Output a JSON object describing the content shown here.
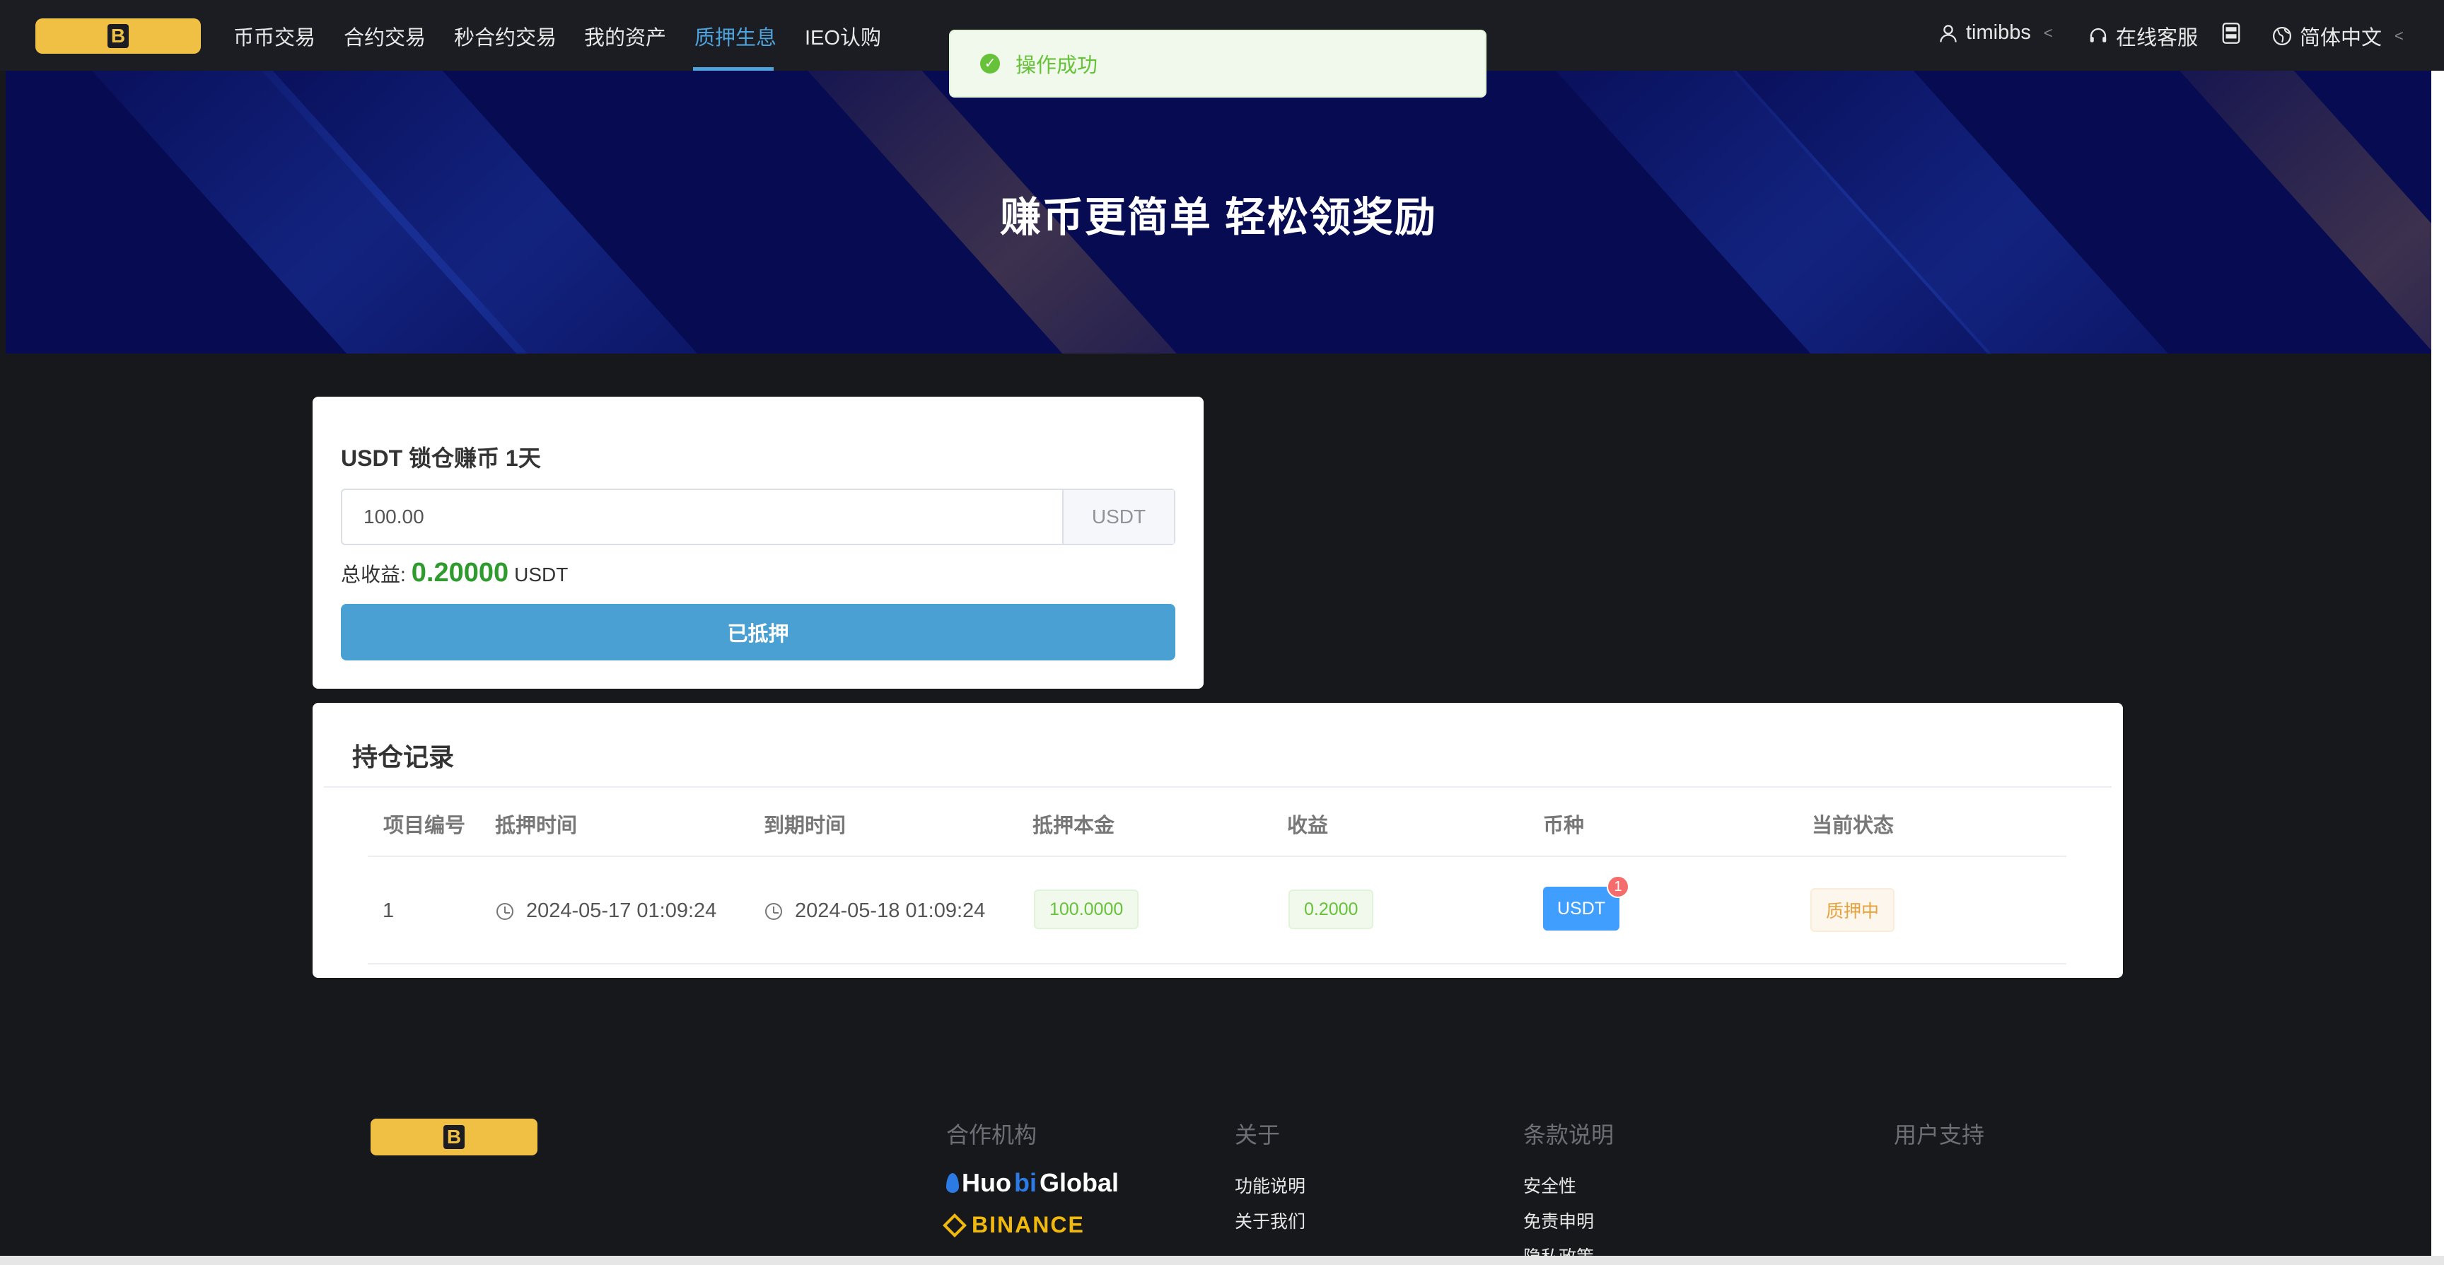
{
  "nav": {
    "items": [
      {
        "label": "币币交易"
      },
      {
        "label": "合约交易"
      },
      {
        "label": "秒合约交易"
      },
      {
        "label": "我的资产"
      },
      {
        "label": "质押生息",
        "active": true
      },
      {
        "label": "IEO认购"
      }
    ],
    "user": "timibbs",
    "support": "在线客服",
    "language": "简体中文",
    "logo_letter": "B"
  },
  "toast": {
    "message": "操作成功",
    "type": "success",
    "color": "#67c23a"
  },
  "banner": {
    "title": "赚币更简单 轻松领奖励",
    "background_color": "#070b52"
  },
  "stake": {
    "title": "USDT 锁仓赚币 1天",
    "amount": "100.00",
    "unit": "USDT",
    "profit_label": "总收益:",
    "profit_value": "0.20000",
    "profit_unit": "USDT",
    "button_label": "已抵押",
    "button_color": "#4ba0d3"
  },
  "records": {
    "title": "持仓记录",
    "columns": [
      "项目编号",
      "抵押时间",
      "到期时间",
      "抵押本金",
      "收益",
      "币种",
      "当前状态"
    ],
    "rows": [
      {
        "id": "1",
        "start_time": "2024-05-17 01:09:24",
        "end_time": "2024-05-18 01:09:24",
        "principal": "100.0000",
        "profit": "0.2000",
        "coin": "USDT",
        "coin_badge": "1",
        "status": "质押中"
      }
    ]
  },
  "footer": {
    "logo_letter": "B",
    "columns": [
      {
        "title": "合作机构",
        "partners": [
          {
            "prefix": "Huo",
            "accent": "bi",
            "suffix": " Global"
          },
          {
            "name": "BINANCE"
          }
        ]
      },
      {
        "title": "关于",
        "links": [
          "功能说明",
          "关于我们"
        ]
      },
      {
        "title": "条款说明",
        "links": [
          "安全性",
          "免责申明",
          "隐私政策"
        ]
      },
      {
        "title": "用户支持",
        "links": []
      }
    ]
  },
  "colors": {
    "accent": "#4ea3dc",
    "brand_yellow": "#efc043",
    "success": "#67c23a",
    "warning": "#e6a23c",
    "primary": "#409eff"
  }
}
